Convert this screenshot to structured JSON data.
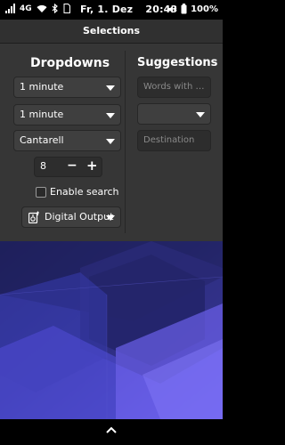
{
  "status_bar": {
    "network_type": "4G",
    "date": "Fr,  1. Dez",
    "time": "20:43",
    "battery": "100%",
    "icons": [
      "signal-icon",
      "wifi-icon",
      "bluetooth-icon",
      "sim-icon",
      "mute-icon",
      "battery-icon"
    ]
  },
  "header": {
    "title": "Selections"
  },
  "dropdowns": {
    "heading": "Dropdowns",
    "items": [
      {
        "value": "1 minute"
      },
      {
        "value": "1 minute"
      },
      {
        "value": "Cantarell"
      }
    ],
    "spin": {
      "value": "8",
      "minus": "−",
      "plus": "+"
    },
    "checkbox": {
      "label": "Enable search",
      "checked": false
    },
    "audio_output": {
      "label": "Digital Output",
      "icon": "audio-output-icon"
    }
  },
  "suggestions": {
    "heading": "Suggestions",
    "search_entry": {
      "placeholder": "Words with …"
    },
    "empty_combo": {
      "value": ""
    },
    "destination_entry": {
      "placeholder": "Destination"
    }
  },
  "colors": {
    "content_bg": "#363636",
    "header_bg": "#303030",
    "wallpaper_blue": "#5b4fe0",
    "wallpaper_dark": "#1a1b4a"
  },
  "bottom_bar": {
    "handle": "chevron-up-icon"
  }
}
